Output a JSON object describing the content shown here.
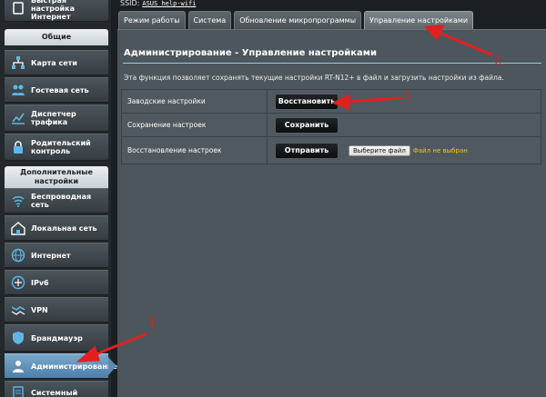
{
  "ssid": {
    "label": "SSID:",
    "value": "ASUS_help-wifi"
  },
  "sidebar": {
    "quick_setup": "Быстрая настройка Интернет",
    "sections": [
      {
        "title": "Общие"
      },
      {
        "title": "Дополнительные настройки"
      }
    ],
    "items": [
      {
        "label": "Карта сети",
        "icon": "network-map-icon"
      },
      {
        "label": "Гостевая сеть",
        "icon": "guest-network-icon"
      },
      {
        "label": "Диспетчер трафика",
        "icon": "traffic-manager-icon"
      },
      {
        "label": "Родительский контроль",
        "icon": "parental-control-icon"
      },
      {
        "label": "Беспроводная сеть",
        "icon": "wireless-icon"
      },
      {
        "label": "Локальная сеть",
        "icon": "lan-icon"
      },
      {
        "label": "Интернет",
        "icon": "globe-icon"
      },
      {
        "label": "IPv6",
        "icon": "ipv6-icon"
      },
      {
        "label": "VPN",
        "icon": "vpn-icon"
      },
      {
        "label": "Брандмауэр",
        "icon": "firewall-icon"
      },
      {
        "label": "Администрирование",
        "icon": "admin-icon",
        "active": true
      },
      {
        "label": "Системный",
        "icon": "system-log-icon"
      }
    ]
  },
  "tabs": [
    {
      "label": "Режим работы"
    },
    {
      "label": "Система"
    },
    {
      "label": "Обновление микропрограммы"
    },
    {
      "label": "Управление настройками",
      "selected": true
    }
  ],
  "panel": {
    "title": "Администрирование - Управление настройками",
    "description": "Эта функция позволяет сохранять текущие настройки RT-N12+ в файл и загрузить настройки из файла.",
    "rows": [
      {
        "label": "Заводские настройки",
        "button": "Восстановить"
      },
      {
        "label": "Сохранение настроек",
        "button": "Сохранить"
      },
      {
        "label": "Восстановление настроек",
        "button": "Отправить",
        "file_button": "Выберите файл",
        "file_status": "Файл не выбран"
      }
    ]
  },
  "annotations": {
    "marks": [
      "1",
      "2",
      "3"
    ],
    "color": "#e0201f"
  },
  "colors": {
    "accent": "#8fd0e8",
    "active_item": "#5b8bb3",
    "file_status": "#f5c518"
  }
}
